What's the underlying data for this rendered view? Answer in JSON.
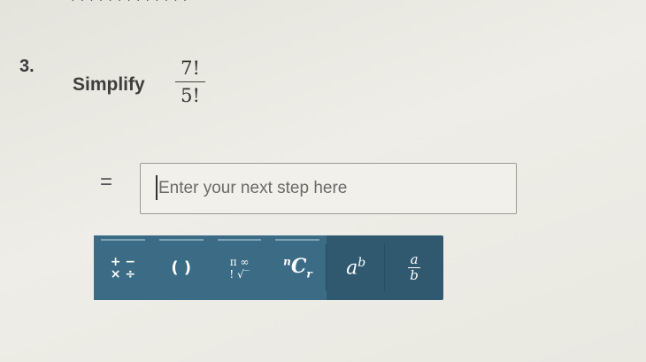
{
  "question": {
    "number": "3.",
    "prompt": "Simplify",
    "numerator": "7!",
    "denominator": "5!"
  },
  "answer": {
    "equals": "=",
    "placeholder": "Enter your next step here"
  },
  "toolbar": {
    "ops_top": "+ −",
    "ops_bottom": "× ÷",
    "parentheses": "( )",
    "func_top": "π ∞",
    "func_bottom": "! √‾",
    "combination": {
      "n": "n",
      "c": "C",
      "r": "r"
    },
    "power": {
      "base": "a",
      "exp": "b"
    },
    "fraction": {
      "num": "a",
      "den": "b"
    },
    "colors": {
      "bar": "#30596f",
      "tab": "#3b6b85"
    }
  }
}
